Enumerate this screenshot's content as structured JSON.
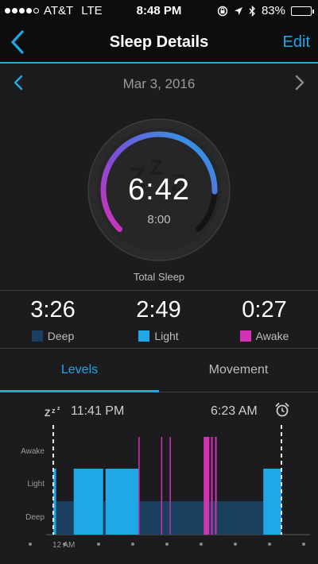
{
  "status_bar": {
    "carrier": "AT&T",
    "network": "LTE",
    "time": "8:48 PM",
    "battery": "83%",
    "battery_level": 0.83,
    "signal_bars": 4,
    "icons": [
      "rotation-lock-icon",
      "location-arrow-icon",
      "bluetooth-icon",
      "battery-icon"
    ]
  },
  "nav": {
    "title": "Sleep Details",
    "edit_label": "Edit",
    "back_icon": "chevron-left-icon"
  },
  "date_nav": {
    "date": "Mar 3, 2016",
    "prev_icon": "chevron-left-icon",
    "next_icon": "chevron-right-icon"
  },
  "summary": {
    "total_sleep": "6:42",
    "goal": "8:00",
    "total_label": "Total Sleep",
    "progress_fraction": 0.84
  },
  "stages": [
    {
      "value": "3:26",
      "label": "Deep",
      "color": "#1b3f5e"
    },
    {
      "value": "2:49",
      "label": "Light",
      "color": "#1fa7e6"
    },
    {
      "value": "0:27",
      "label": "Awake",
      "color": "#d232b4"
    }
  ],
  "tabs": [
    {
      "label": "Levels",
      "active": true
    },
    {
      "label": "Movement",
      "active": false
    }
  ],
  "chart_header": {
    "start_time": "11:41 PM",
    "end_time": "6:23 AM",
    "sleep_icon": "zzz-icon",
    "alarm_icon": "alarm-clock-icon"
  },
  "chart_data": {
    "type": "area",
    "title": "",
    "levels": [
      "Awake",
      "Light",
      "Deep"
    ],
    "x_tick_labels": [
      "12 AM"
    ],
    "x_range_minutes": [
      0,
      402
    ],
    "segments": [
      {
        "start": 0,
        "end": 5,
        "level": "Light"
      },
      {
        "start": 5,
        "end": 36,
        "level": "Deep"
      },
      {
        "start": 36,
        "end": 88,
        "level": "Light"
      },
      {
        "start": 88,
        "end": 92,
        "level": "Deep"
      },
      {
        "start": 92,
        "end": 150,
        "level": "Light"
      },
      {
        "start": 150,
        "end": 152,
        "level": "Awake"
      },
      {
        "start": 152,
        "end": 190,
        "level": "Deep"
      },
      {
        "start": 190,
        "end": 192,
        "level": "Awake"
      },
      {
        "start": 192,
        "end": 205,
        "level": "Deep"
      },
      {
        "start": 205,
        "end": 207,
        "level": "Awake"
      },
      {
        "start": 207,
        "end": 265,
        "level": "Deep"
      },
      {
        "start": 265,
        "end": 275,
        "level": "Awake"
      },
      {
        "start": 275,
        "end": 278,
        "level": "Deep"
      },
      {
        "start": 278,
        "end": 281,
        "level": "Awake"
      },
      {
        "start": 281,
        "end": 285,
        "level": "Deep"
      },
      {
        "start": 285,
        "end": 288,
        "level": "Awake"
      },
      {
        "start": 288,
        "end": 370,
        "level": "Deep"
      },
      {
        "start": 370,
        "end": 402,
        "level": "Light"
      }
    ],
    "colors": {
      "Deep": "#1b3f5e",
      "Light": "#1fa7e6",
      "Awake": "#d232b4"
    }
  }
}
